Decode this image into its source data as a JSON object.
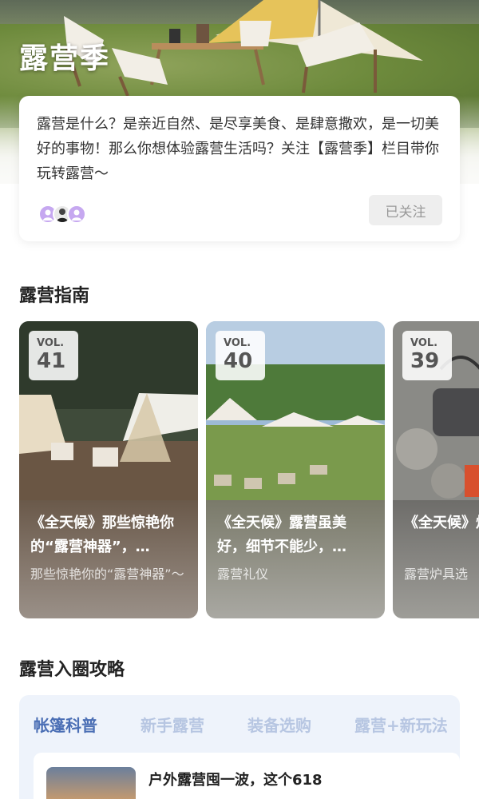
{
  "hero": {
    "title": "露营季"
  },
  "intro": {
    "text": "露营是什么？是亲近自然、是尽享美食、是肆意撒欢，是一切美好的事物！那么你想体验露营生活吗？关注【露营季】栏目带你玩转露营～",
    "follow_label": "已关注"
  },
  "guide": {
    "section_title": "露营指南",
    "cards": [
      {
        "vol_label": "VOL.",
        "vol": "41",
        "title": "《全天候》那些惊艳你的“露营神器”，…",
        "subtitle": "那些惊艳你的“露营神器”～"
      },
      {
        "vol_label": "VOL.",
        "vol": "40",
        "title": "《全天候》露营虽美好，细节不能少，…",
        "subtitle": "露营礼仪"
      },
      {
        "vol_label": "VOL.",
        "vol": "39",
        "title": "《全天候》炉具怎么选",
        "subtitle": "露营炉具选"
      }
    ]
  },
  "strategy": {
    "section_title": "露营入圈攻略",
    "tabs": [
      {
        "label": "帐篷科普"
      },
      {
        "label": "新手露营"
      },
      {
        "label": "装备选购"
      },
      {
        "label": "露营+新玩法"
      }
    ],
    "article": {
      "title": "户外露营囤一波，这个618"
    }
  },
  "colors": {
    "accent": "#4b6fb5",
    "tab_inactive": "#b7c6e2",
    "avatar_purple": "#c6a8f0"
  }
}
